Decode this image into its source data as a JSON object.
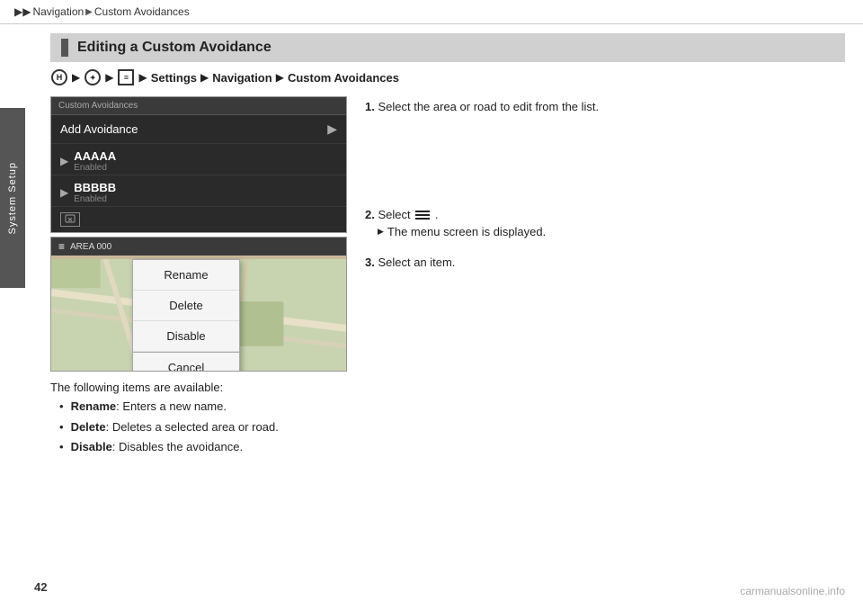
{
  "topbar": {
    "arrow1": "▶▶",
    "crumb1": "Navigation",
    "arrow2": "▶",
    "crumb2": "Custom Avoidances"
  },
  "sidebar": {
    "label": "System Setup"
  },
  "section": {
    "heading": "Editing a Custom Avoidance"
  },
  "navpath": {
    "home_icon": "H",
    "settings": "Settings",
    "navigation": "Navigation",
    "custom_avoidances": "Custom Avoidances"
  },
  "screenshot1": {
    "header": "Custom Avoidances",
    "add_row": "Add Avoidance",
    "item1_name": "AAAAA",
    "item1_sub": "Enabled",
    "item2_name": "BBBBB",
    "item2_sub": "Enabled"
  },
  "screenshot2": {
    "menu_icon": "≡",
    "area_label": "AREA 000"
  },
  "dropdown": {
    "rename": "Rename",
    "delete": "Delete",
    "disable": "Disable",
    "cancel": "Cancel"
  },
  "steps": {
    "step1_num": "1.",
    "step1_text": "Select the area or road to edit from the list.",
    "step2_num": "2.",
    "step2_text": "Select",
    "step2_cont": ".",
    "step2_arrow": "The menu screen is displayed.",
    "step3_num": "3.",
    "step3_text": "Select an item."
  },
  "below": {
    "intro": "The following items are available:",
    "items": [
      {
        "label": "Rename",
        "desc": ": Enters a new name."
      },
      {
        "label": "Delete",
        "desc": ": Deletes a selected area or road."
      },
      {
        "label": "Disable",
        "desc": ": Disables the avoidance."
      }
    ]
  },
  "page_number": "42",
  "watermark": "carmanualsonline.info"
}
